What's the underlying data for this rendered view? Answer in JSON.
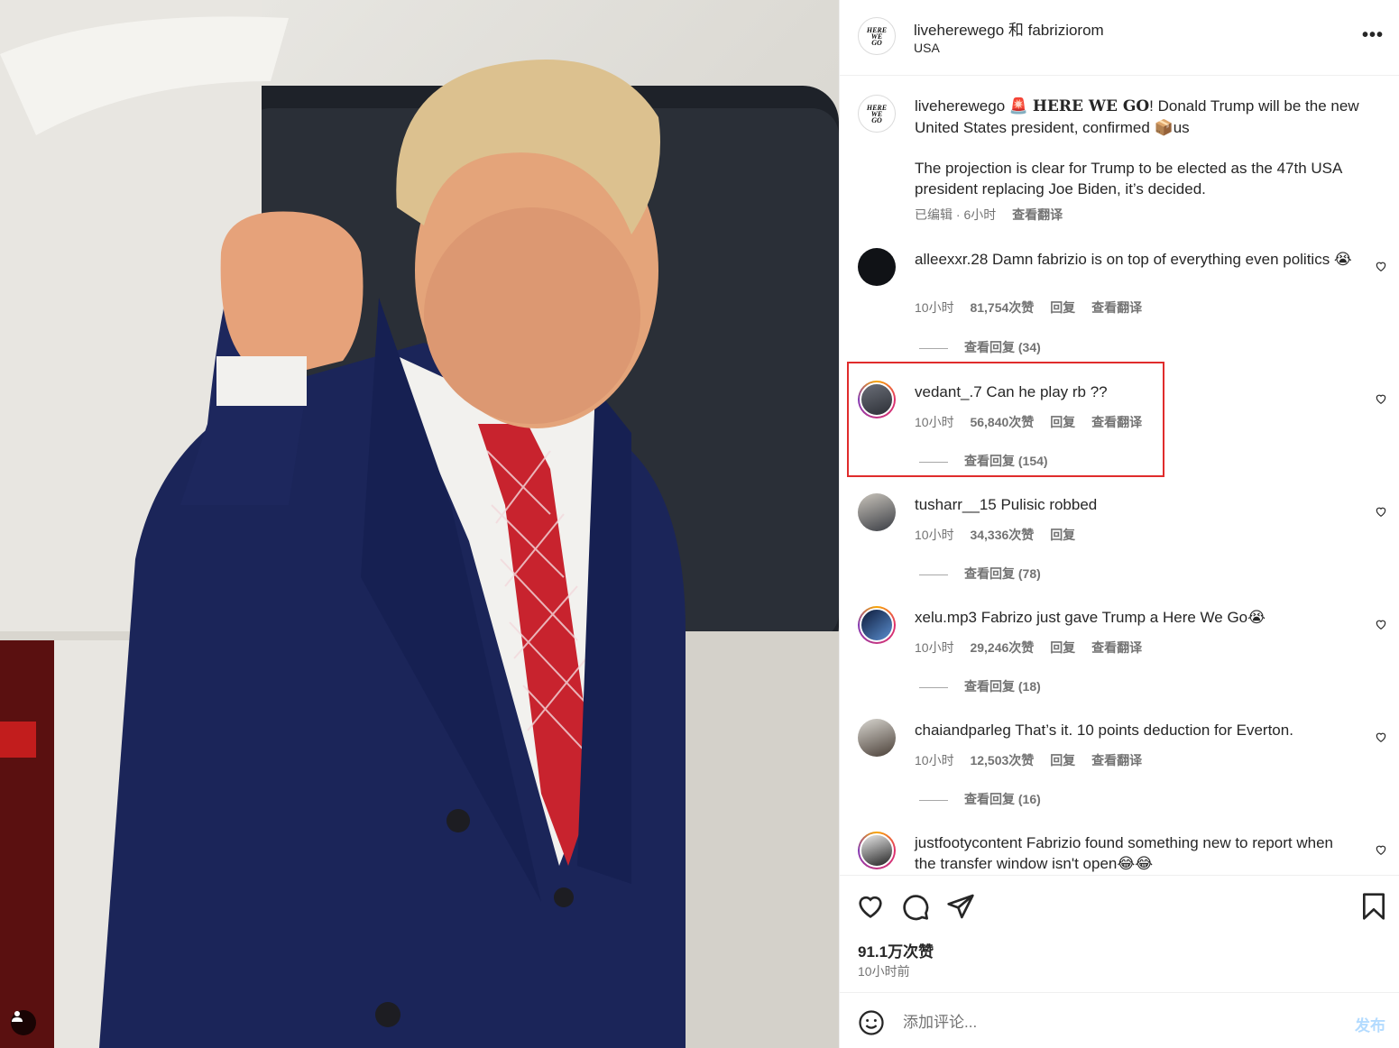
{
  "post": {
    "photo_alt": "",
    "user_tag_icon": "person-icon"
  },
  "header": {
    "users": "liveherewego 和 fabriziorom",
    "location": "USA",
    "more_icon": "more-icon",
    "more_label": "•••"
  },
  "caption": {
    "username": "liveherewego",
    "siren": "🚨",
    "hwg": "𝐇𝐄𝐑𝐄 𝐖𝐄 𝐆𝐎",
    "text1": "! Donald Trump will be the new United States president, confirmed 📦us",
    "text2": "The projection is clear for Trump to be elected as the 47th USA president replacing Joe Biden, it’s decided.",
    "edited": "已编辑 · 6小时",
    "translate": "查看翻译"
  },
  "comments": [
    {
      "username": "alleexxr.28",
      "text": "Damn fabrizio is on top of everything even politics 😭",
      "time": "10小时",
      "likes": "81,754次赞",
      "reply": "回复",
      "translate": "查看翻译",
      "view_replies": "查看回复 (34)"
    },
    {
      "username": "vedant_.7",
      "text": "Can he play rb ??",
      "time": "10小时",
      "likes": "56,840次赞",
      "reply": "回复",
      "translate": "查看翻译",
      "view_replies": "查看回复 (154)"
    },
    {
      "username": "tusharr__15",
      "text": "Pulisic robbed",
      "time": "10小时",
      "likes": "34,336次赞",
      "reply": "回复",
      "translate": "",
      "view_replies": "查看回复 (78)"
    },
    {
      "username": "xelu.mp3",
      "text": "Fabrizo just gave Trump a Here We Go😭",
      "time": "10小时",
      "likes": "29,246次赞",
      "reply": "回复",
      "translate": "查看翻译",
      "view_replies": "查看回复 (18)"
    },
    {
      "username": "chaiandparleg",
      "text": "That’s it. 10 points deduction for Everton.",
      "time": "10小时",
      "likes": "12,503次赞",
      "reply": "回复",
      "translate": "查看翻译",
      "view_replies": "查看回复 (16)"
    },
    {
      "username": "justfootycontent",
      "text": "Fabrizio found something new to report when the transfer window isn't open😂😂",
      "time": "",
      "likes": "",
      "reply": "",
      "translate": "",
      "view_replies": ""
    }
  ],
  "actions": {
    "like_icon": "heart-icon",
    "comment_icon": "comment-icon",
    "share_icon": "share-icon",
    "save_icon": "bookmark-icon",
    "likes": "91.1万次赞",
    "time": "10小时前"
  },
  "composer": {
    "emoji_icon": "emoji-icon",
    "placeholder": "添加评论...",
    "value": "",
    "post_label": "发布"
  },
  "colors": {
    "highlight_box": "#e02c2c",
    "post_disabled": "#b3dbff",
    "muted_text": "#737373"
  }
}
